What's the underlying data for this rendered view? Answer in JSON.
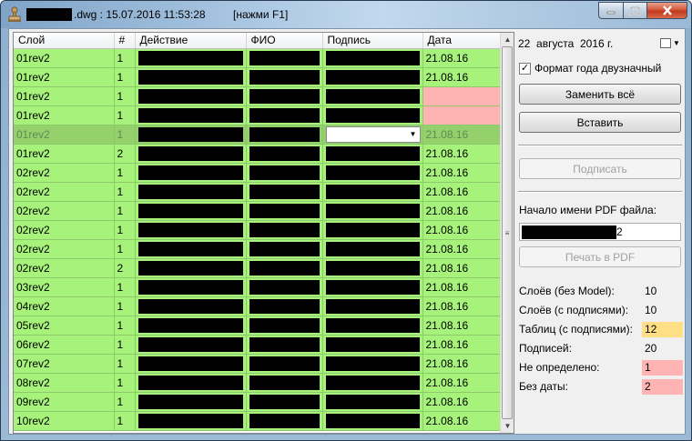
{
  "window": {
    "title_filename_suffix": ".dwg : 15.07.2016 11:53:28",
    "title_hint": "[нажми F1]"
  },
  "grid": {
    "columns": [
      "Слой",
      "#",
      "Действие",
      "ФИО",
      "Подпись",
      "Дата"
    ],
    "rows": [
      {
        "layer": "01rev2",
        "num": "1",
        "date": "21.08.16",
        "state": "normal"
      },
      {
        "layer": "01rev2",
        "num": "1",
        "date": "21.08.16",
        "state": "normal"
      },
      {
        "layer": "01rev2",
        "num": "1",
        "date": "",
        "state": "missing-date"
      },
      {
        "layer": "01rev2",
        "num": "1",
        "date": "",
        "state": "missing-date"
      },
      {
        "layer": "01rev2",
        "num": "1",
        "date": "21.08.16",
        "state": "selected"
      },
      {
        "layer": "01rev2",
        "num": "2",
        "date": "21.08.16",
        "state": "normal"
      },
      {
        "layer": "02rev2",
        "num": "1",
        "date": "21.08.16",
        "state": "normal"
      },
      {
        "layer": "02rev2",
        "num": "1",
        "date": "21.08.16",
        "state": "normal"
      },
      {
        "layer": "02rev2",
        "num": "1",
        "date": "21.08.16",
        "state": "normal"
      },
      {
        "layer": "02rev2",
        "num": "1",
        "date": "21.08.16",
        "state": "normal"
      },
      {
        "layer": "02rev2",
        "num": "1",
        "date": "21.08.16",
        "state": "normal"
      },
      {
        "layer": "02rev2",
        "num": "2",
        "date": "21.08.16",
        "state": "normal"
      },
      {
        "layer": "03rev2",
        "num": "1",
        "date": "21.08.16",
        "state": "normal"
      },
      {
        "layer": "04rev2",
        "num": "1",
        "date": "21.08.16",
        "state": "normal"
      },
      {
        "layer": "05rev2",
        "num": "1",
        "date": "21.08.16",
        "state": "normal"
      },
      {
        "layer": "06rev2",
        "num": "1",
        "date": "21.08.16",
        "state": "normal"
      },
      {
        "layer": "07rev2",
        "num": "1",
        "date": "21.08.16",
        "state": "normal"
      },
      {
        "layer": "08rev2",
        "num": "1",
        "date": "21.08.16",
        "state": "normal"
      },
      {
        "layer": "09rev2",
        "num": "1",
        "date": "21.08.16",
        "state": "normal"
      },
      {
        "layer": "10rev2",
        "num": "1",
        "date": "21.08.16",
        "state": "normal"
      }
    ]
  },
  "panel": {
    "date_text": "22  августа  2016 г.",
    "two_digit_year_label": "Формат года двузначный",
    "two_digit_year_checked": true,
    "replace_all_button": "Заменить всё",
    "insert_button": "Вставить",
    "sign_button": "Подписать",
    "pdf_prefix_label": "Начало имени PDF файла:",
    "pdf_prefix_value_suffix": "2",
    "print_pdf_button": "Печать в PDF",
    "stats": [
      {
        "label": "Слоёв (без Model):",
        "value": "10",
        "highlight": ""
      },
      {
        "label": "Слоёв (с подписями):",
        "value": "10",
        "highlight": ""
      },
      {
        "label": "Таблиц (с подписями):",
        "value": "12",
        "highlight": "yellow"
      },
      {
        "label": "Подписей:",
        "value": "20",
        "highlight": ""
      },
      {
        "label": "Не определено:",
        "value": "1",
        "highlight": "pink"
      },
      {
        "label": "Без даты:",
        "value": "2",
        "highlight": "pink"
      }
    ]
  },
  "colors": {
    "row_ok": "#a6f27a",
    "row_selected": "#94d06c",
    "missing": "#ffb3b3",
    "highlight_yellow": "#ffdf86"
  }
}
